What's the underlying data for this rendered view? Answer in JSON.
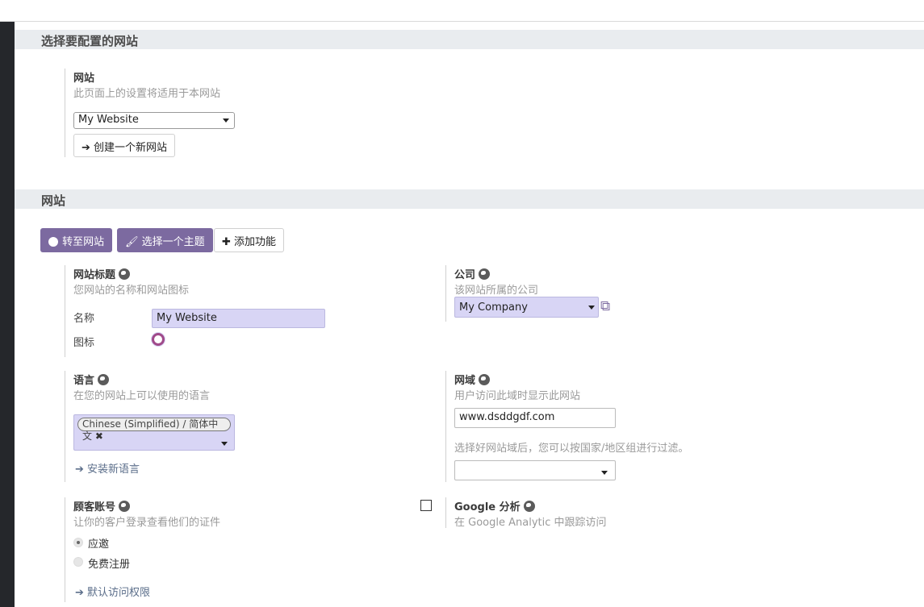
{
  "section1": {
    "title": "选择要配置的网站",
    "website_label": "网站",
    "website_desc": "此页面上的设置将适用于本网站",
    "website_select": "My Website",
    "create_button": "创建一个新网站"
  },
  "section2": {
    "title": "网站",
    "buttons": {
      "goto": "转至网站",
      "theme": "选择一个主题",
      "add_feature": "添加功能"
    },
    "site_title": {
      "label": "网站标题",
      "desc": "您网站的名称和网站图标",
      "name_label": "名称",
      "name_value": "My Website",
      "icon_label": "图标"
    },
    "company": {
      "label": "公司",
      "desc": "该网站所属的公司",
      "value": "My Company"
    },
    "language": {
      "label": "语言",
      "desc": "在您的网站上可以使用的语言",
      "tag": "Chinese (Simplified) / 简体中文",
      "install_link": "安装新语言"
    },
    "domain": {
      "label": "网域",
      "desc": "用户访问此域时显示此网站",
      "value": "www.dsddgdf.com",
      "filter_desc": "选择好网站域后，您可以按国家/地区组进行过滤。",
      "country_select": ""
    },
    "customer_account": {
      "label": "顾客账号",
      "desc": "让你的客户登录查看他们的证件",
      "option1": "应邀",
      "option2": "免费注册",
      "access_link": "默认访问权限"
    },
    "google": {
      "label": "Google 分析",
      "desc": "在 Google Analytic 中跟踪访问"
    }
  },
  "colors": {
    "primary": "#7c6aa0",
    "field_bg": "#d8d5f5",
    "sidebar": "#25272b",
    "section_bg": "#e9ecef"
  }
}
